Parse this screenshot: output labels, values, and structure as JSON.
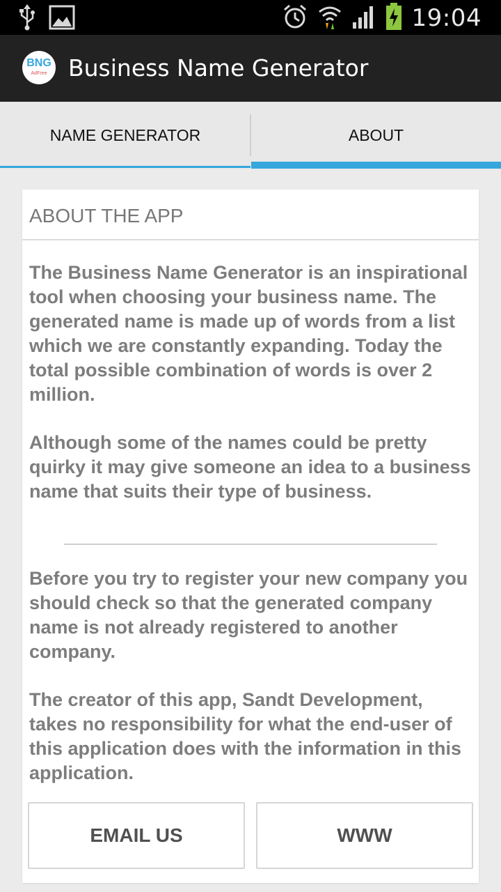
{
  "status_bar": {
    "time": "19:04",
    "icons": [
      "usb-icon",
      "image-icon",
      "alarm-icon",
      "wifi-icon",
      "signal-icon",
      "battery-charging-icon"
    ]
  },
  "action_bar": {
    "logo_text": "BNG",
    "logo_subtext": "AdFree",
    "title": "Business Name Generator"
  },
  "tabs": [
    {
      "label": "NAME GENERATOR",
      "selected": false
    },
    {
      "label": "ABOUT",
      "selected": true
    }
  ],
  "about": {
    "header": "ABOUT THE APP",
    "paragraphs": [
      "The Business Name Generator is an inspirational tool when choosing your business name. The generated name is made up of words from a list which we are constantly expanding. Today the total possible combination of words is over 2 million.",
      "Although some of the names could be pretty quirky it may give someone an idea to a business name that suits their type of business.",
      "Before you try to register your new company you should check so that the generated company name is not already registered to another company.",
      "The creator of this app, Sandt Development, takes no responsibility for what the end-user of this application does with the information in this application."
    ],
    "buttons": {
      "email": "EMAIL US",
      "www": "WWW"
    }
  },
  "colors": {
    "accent": "#35a7dd",
    "action_bar": "#222222",
    "background": "#ebebeb",
    "text_gray": "#7d7d7d"
  }
}
